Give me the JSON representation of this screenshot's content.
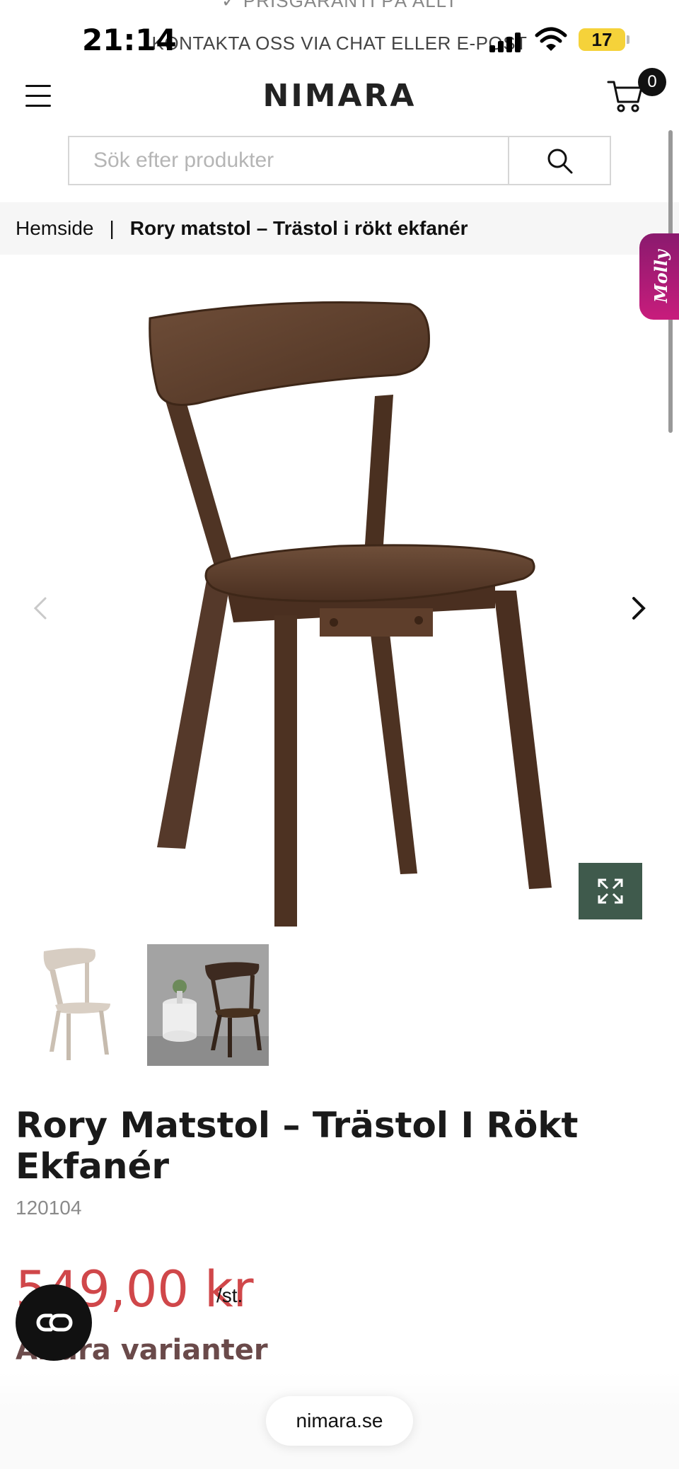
{
  "status_bar": {
    "time": "21:14",
    "battery": "17",
    "ticker_top": "✓ PRISGARANTI PÅ ALLT",
    "ticker_mid": "KONTAKTA OSS VIA CHAT ELLER E-POST"
  },
  "header": {
    "logo": "NIMARA",
    "cart_count": "0",
    "icons": [
      "menu-icon",
      "cart-icon"
    ]
  },
  "search": {
    "placeholder": "Sök efter produkter",
    "icon": "search-icon"
  },
  "breadcrumb": {
    "home": "Hemside",
    "separator": "|",
    "current": "Rory matstol – Trästol i rökt ekfanér"
  },
  "chat_tab": {
    "label": "Molly"
  },
  "gallery": {
    "icons": [
      "chevron-left-icon",
      "chevron-right-icon",
      "expand-icon"
    ]
  },
  "product": {
    "title": "Rory Matstol – Trästol I Rökt Ekfanér",
    "sku": "120104",
    "price": "549,00 kr",
    "unit": "/st.",
    "variants_heading": "Andra varianter"
  },
  "browser": {
    "address": "nimara.se"
  },
  "colors": {
    "price": "#d0474a",
    "zoom_button": "#3f5a4c",
    "molly_tab": "#b01b78",
    "battery": "#f5d23a"
  }
}
